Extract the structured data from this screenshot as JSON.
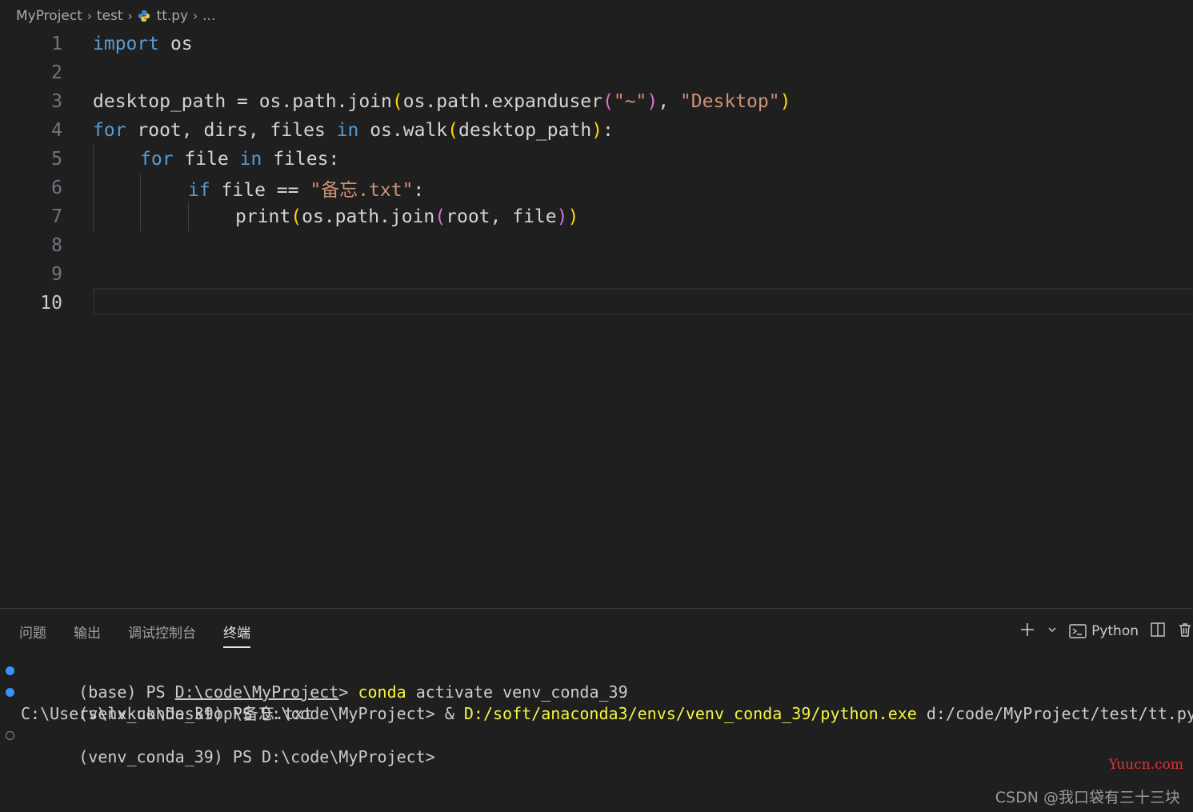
{
  "breadcrumb": {
    "project": "MyProject",
    "folder": "test",
    "file": "tt.py",
    "more": "..."
  },
  "editor": {
    "line_numbers": [
      "1",
      "2",
      "3",
      "4",
      "5",
      "6",
      "7",
      "8",
      "9",
      "10"
    ],
    "active_line": "10",
    "code": {
      "l1": {
        "kw": "import",
        "mod": " os"
      },
      "l3": {
        "a": "desktop_path = os.path.join",
        "b": "(",
        "c": "os.path.expanduser",
        "d": "(",
        "e": "\"~\"",
        "f": ")",
        "g": ", ",
        "h": "\"Desktop\"",
        "i": ")"
      },
      "l4": {
        "kw": "for",
        "a": " root, dirs, files ",
        "in": "in",
        "b": " os.walk",
        "c": "(",
        "d": "desktop_path",
        "e": ")",
        "f": ":"
      },
      "l5": {
        "kw": "for",
        "a": " file ",
        "in": "in",
        "b": " files:"
      },
      "l6": {
        "kw": "if",
        "a": " file == ",
        "s": "\"备忘.txt\"",
        "b": ":"
      },
      "l7": {
        "fn": "print",
        "a": "(",
        "b": "os.path.join",
        "c": "(",
        "d": "root, file",
        "e": ")",
        "f": ")"
      }
    }
  },
  "panel": {
    "tabs": [
      "问题",
      "输出",
      "调试控制台",
      "终端"
    ],
    "active_tab": "终端",
    "actions": {
      "add_label": "+",
      "profile": "Python"
    }
  },
  "terminal": {
    "lines": [
      {
        "prefix": "(base) PS ",
        "path": "D:\\code\\MyProject",
        "prompt": "> ",
        "cmd": "conda",
        "rest": " activate venv_conda_39"
      },
      {
        "prefix": "(venv_conda_39) PS D:\\code\\MyProject> & ",
        "exe": "D:/soft/anaconda3/envs/venv_conda_39/python.exe",
        "rest": " d:/code/MyProject/test/tt.py"
      },
      {
        "text": "C:\\Users\\lxkuk\\Desktop\\备忘.txt"
      },
      {
        "text": "(venv_conda_39) PS D:\\code\\MyProject>"
      }
    ]
  },
  "watermarks": {
    "site": "Yuucn.com",
    "author": "CSDN @我口袋有三十三块"
  },
  "colors": {
    "keyword": "#569cd6",
    "string": "#ce9178",
    "bracket1": "#ffd700",
    "bracket2": "#da70d6",
    "terminal_yellow": "#f5f543",
    "status_dot": "#3794ff"
  }
}
